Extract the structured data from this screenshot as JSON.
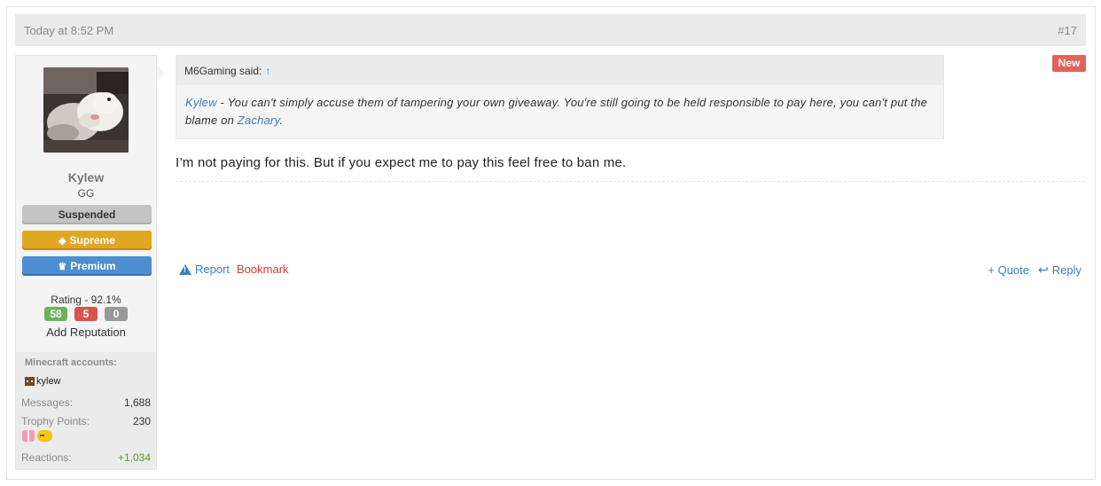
{
  "post": {
    "timestamp": "Today at 8:52 PM",
    "number": "#17",
    "new_badge": "New"
  },
  "author": {
    "username": "Kylew",
    "title": "GG",
    "badges": {
      "suspended": "Suspended",
      "supreme": "Supreme",
      "premium": "Premium"
    },
    "rating_label": "Rating - 92.1%",
    "rating_positive": "58",
    "rating_negative": "5",
    "rating_neutral": "0",
    "add_reputation": "Add Reputation",
    "minecraft_title": "Minecraft accounts:",
    "minecraft_account": "kylew",
    "stats": {
      "messages_label": "Messages:",
      "messages_value": "1,688",
      "trophy_label": "Trophy Points:",
      "trophy_value": "230",
      "reactions_label": "Reactions:",
      "reactions_value": "+1,034"
    }
  },
  "quote": {
    "author_said": "M6Gaming said:",
    "up_arrow": "↑",
    "mention": "Kylew",
    "text_part1": " - You can't simply accuse them of tampering your own giveaway. You're still going to be held responsible to pay here, you can't put the blame on ",
    "mention2": "Zachary",
    "text_part2": "."
  },
  "message": "I’m not paying for this. But if you expect me to pay this feel free to ban me.",
  "actions": {
    "report": "Report",
    "bookmark": "Bookmark",
    "quote": "+ Quote",
    "reply": "Reply"
  }
}
